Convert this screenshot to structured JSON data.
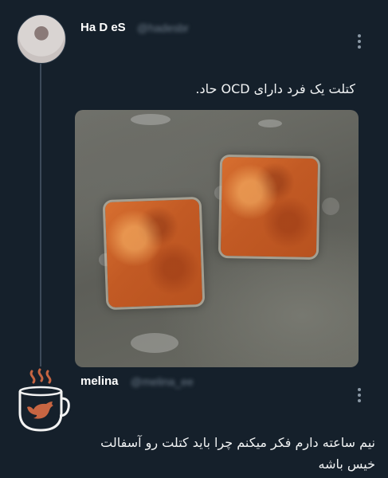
{
  "tweet1": {
    "display_name": "Ha D eS",
    "handle": "@hadesbr",
    "text": "کتلت یک فرد دارای OCD حاد.",
    "avatar_icon": "avatar-photo",
    "more_icon": "more-vertical-icon",
    "image_alt": "two square fried cutlets in oil"
  },
  "tweet2": {
    "display_name": "melina",
    "handle": "@melina_ee",
    "text": "نیم ساعته دارم فکر میکنم چرا باید کتلت رو آسفالت خیس باشه",
    "avatar_icon": "coffee-cup-bird-icon",
    "more_icon": "more-vertical-icon"
  },
  "colors": {
    "background": "#15202b",
    "text": "#e7e9ea",
    "muted": "#8b98a5",
    "thread_line": "#3d4a5a",
    "avatar2_accent": "#c76542"
  }
}
